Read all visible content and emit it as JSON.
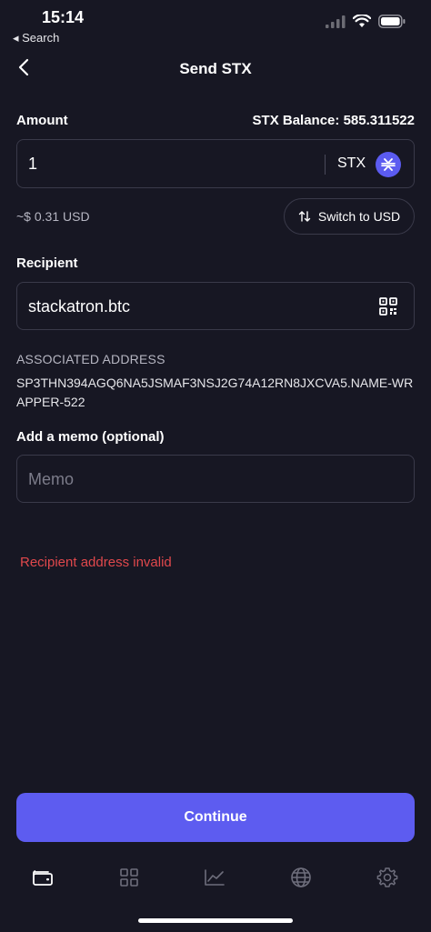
{
  "status_bar": {
    "time": "15:14",
    "back_label": "◂ Search"
  },
  "header": {
    "title": "Send STX",
    "back_icon": "chevron-left-icon"
  },
  "amount": {
    "label": "Amount",
    "balance_text": "STX Balance: 585.311522",
    "value": "1",
    "currency": "STX",
    "fiat_estimate": "~$ 0.31 USD",
    "switch_label": "Switch to USD"
  },
  "recipient": {
    "label": "Recipient",
    "value": "stackatron.btc",
    "associated_label": "ASSOCIATED ADDRESS",
    "associated_address": "SP3THN394AGQ6NA5JSMAF3NSJ2G74A12RN8JXCVA5.NAME-WRAPPER-522"
  },
  "memo": {
    "label": "Add a memo (optional)",
    "placeholder": "Memo",
    "value": ""
  },
  "error": {
    "text": "Recipient address invalid",
    "color": "#e0484c"
  },
  "continue_label": "Continue",
  "colors": {
    "background": "#171723",
    "accent": "#5d5cf0",
    "border": "#3a3a4a"
  },
  "tabs": [
    {
      "icon": "wallet-icon",
      "active": true
    },
    {
      "icon": "grid-icon",
      "active": false
    },
    {
      "icon": "chart-icon",
      "active": false
    },
    {
      "icon": "globe-icon",
      "active": false
    },
    {
      "icon": "gear-icon",
      "active": false
    }
  ]
}
